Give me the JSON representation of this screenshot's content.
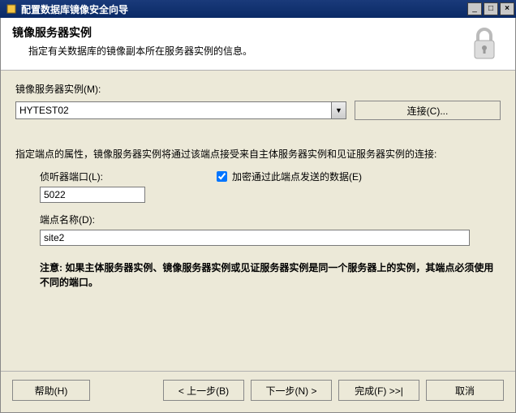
{
  "titlebar": {
    "title": "配置数据库镜像安全向导"
  },
  "header": {
    "title": "镜像服务器实例",
    "subtitle": "指定有关数据库的镜像副本所在服务器实例的信息。"
  },
  "server_instance": {
    "label": "镜像服务器实例(M):",
    "value": "HYTEST02",
    "connect_label": "连接(C)..."
  },
  "endpoint": {
    "description": "指定端点的属性，镜像服务器实例将通过该端点接受来自主体服务器实例和见证服务器实例的连接:",
    "port_label": "侦听器端口(L):",
    "port_value": "5022",
    "encrypt_label": "加密通过此端点发送的数据(E)",
    "encrypt_checked": true,
    "name_label": "端点名称(D):",
    "name_value": "site2",
    "note": "注意: 如果主体服务器实例、镜像服务器实例或见证服务器实例是同一个服务器上的实例，其端点必须使用不同的端口。"
  },
  "footer": {
    "help": "帮助(H)",
    "back": "< 上一步(B)",
    "next": "下一步(N) >",
    "finish": "完成(F) >>|",
    "cancel": "取消"
  }
}
